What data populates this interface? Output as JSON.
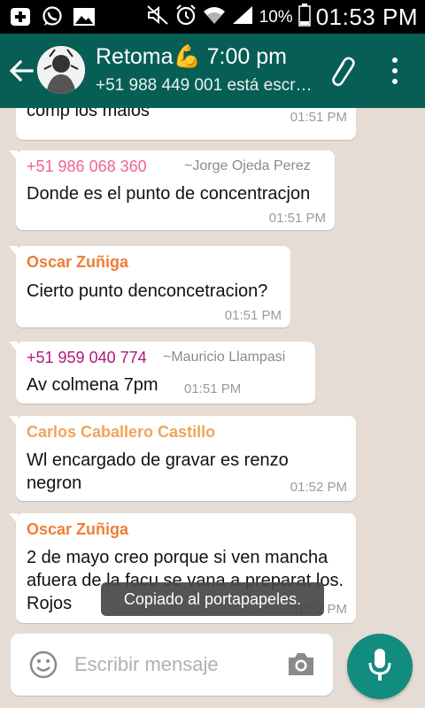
{
  "status_bar": {
    "battery_percent": "10%",
    "time": "01:53 PM",
    "left_icons": [
      "add-icon",
      "whatsapp-icon",
      "image-icon"
    ],
    "right_icons": [
      "mute-icon",
      "alarm-icon",
      "wifi-icon",
      "signal-icon",
      "battery-icon"
    ]
  },
  "header": {
    "title": "Retoma💪 7:00 pm",
    "subtitle": "+51 988 449 001 está escr…"
  },
  "messages": [
    {
      "sender": "",
      "alias": "",
      "text": "comp los malos",
      "time": "01:51 PM"
    },
    {
      "sender": "+51 986 068 360",
      "alias": "~Jorge Ojeda Perez",
      "text": "Donde es el punto de concentracjon",
      "time": "01:51 PM",
      "sender_color": "#f06292"
    },
    {
      "sender": "Oscar Zuñiga",
      "alias": "",
      "text": "Cierto punto denconcetracion?",
      "time": "01:51 PM",
      "sender_color": "#ef7d34"
    },
    {
      "sender": "+51 959 040 774",
      "alias": "~Mauricio Llampasi",
      "text": "Av colmena 7pm",
      "time": "01:51 PM",
      "sender_color": "#b0177b"
    },
    {
      "sender": "Carlos Caballero Castillo",
      "alias": "",
      "text": "Wl encargado de gravar es renzo negron",
      "time": "01:52 PM",
      "sender_color": "#f0a45a"
    },
    {
      "sender": "Oscar Zuñiga",
      "alias": "",
      "text": "2 de mayo creo porque si ven mancha afuera de la facu se vana a preparat los. Rojos",
      "time": "01:52 PM",
      "sender_color": "#ef7d34"
    }
  ],
  "toast": "Copiado al portapapeles.",
  "composer": {
    "placeholder": "Escribir mensaje"
  },
  "colors": {
    "app_bar": "#075e54",
    "chat_background": "#e5ddd5",
    "mic_button": "#128c7e"
  }
}
